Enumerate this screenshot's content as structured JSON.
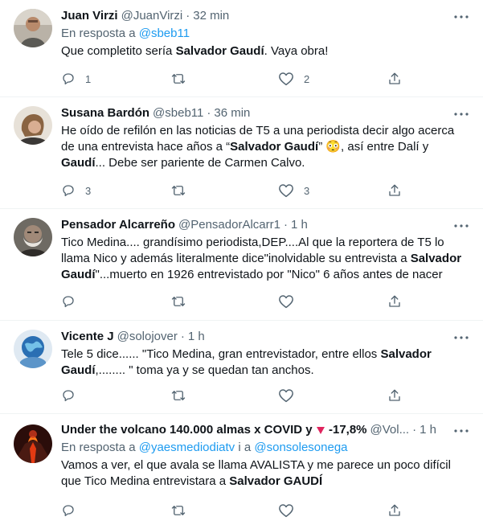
{
  "feed": {
    "tweets": [
      {
        "name": "Juan Virzi",
        "handle": "@JuanVirzi",
        "time": "32 min",
        "reply_prefix": "En resposta a",
        "reply_to": "@sbeb11",
        "text_segments": [
          {
            "t": "Que completito sería ",
            "b": false
          },
          {
            "t": "Salvador Gaudí",
            "b": true
          },
          {
            "t": ". Vaya obra!",
            "b": false
          }
        ],
        "replies": "1",
        "retweets": "",
        "likes": "2"
      },
      {
        "name": "Susana Bardón",
        "handle": "@sbeb11",
        "time": "36 min",
        "text_segments": [
          {
            "t": "He oído de refilón en las noticias de T5 a una periodista decir algo acerca de una entrevista hace años a “",
            "b": false
          },
          {
            "t": "Salvador Gaudí",
            "b": true
          },
          {
            "t": "” 😳, así entre Dalí y ",
            "b": false
          },
          {
            "t": "Gaudí",
            "b": true
          },
          {
            "t": "... Debe ser pariente de Carmen Calvo.",
            "b": false
          }
        ],
        "replies": "3",
        "retweets": "",
        "likes": "3"
      },
      {
        "name": "Pensador Alcarreño",
        "handle": "@PensadorAlcarr1",
        "time": "1 h",
        "text_segments": [
          {
            "t": "Tico Medina.... grandísimo periodista,DEP....Al que la reportera de T5 lo llama Nico y además literalmente dice\"inolvidable su entrevista a ",
            "b": false
          },
          {
            "t": "Salvador Gaudí",
            "b": true
          },
          {
            "t": "\"...muerto en 1926 entrevistado por \"Nico\" 6 años antes de nacer",
            "b": false
          }
        ],
        "replies": "",
        "retweets": "",
        "likes": ""
      },
      {
        "name": "Vicente J",
        "handle": "@solojover",
        "time": "1 h",
        "text_segments": [
          {
            "t": "Tele 5 dice...... \"Tico Medina, gran entrevistador, entre ellos ",
            "b": false
          },
          {
            "t": "Salvador Gaudí",
            "b": true
          },
          {
            "t": ",........ \" toma ya y se quedan tan anchos.",
            "b": false
          }
        ],
        "replies": "",
        "retweets": "",
        "likes": ""
      },
      {
        "name_before": "Under the volcano 140.000 almas x COVID y ",
        "name_after": " -17,8%",
        "handle": "@Vol...",
        "time": "1 h",
        "reply_prefix": "En resposta a",
        "reply_to": "@yaesmediodiatv",
        "reply_joiner": "i a",
        "reply_to_2": "@sonsolesonega",
        "text_segments": [
          {
            "t": "Vamos a ver, el que avala se llama AVALISTA y me parece un poco difícil que Tico Medina entrevistara a ",
            "b": false
          },
          {
            "t": "Salvador GAUDÍ",
            "b": true
          }
        ],
        "replies": "",
        "retweets": "",
        "likes": ""
      }
    ]
  },
  "icons": {
    "more": "more-dots-icon",
    "reply": "reply-bubble-icon",
    "retweet": "retweet-arrows-icon",
    "like": "heart-icon",
    "share": "share-upload-icon",
    "flag": "red-triangle-icon"
  },
  "colors": {
    "text": "#0f1419",
    "secondary": "#536471",
    "link": "#1d9bf0",
    "divider": "#eff3f4"
  }
}
